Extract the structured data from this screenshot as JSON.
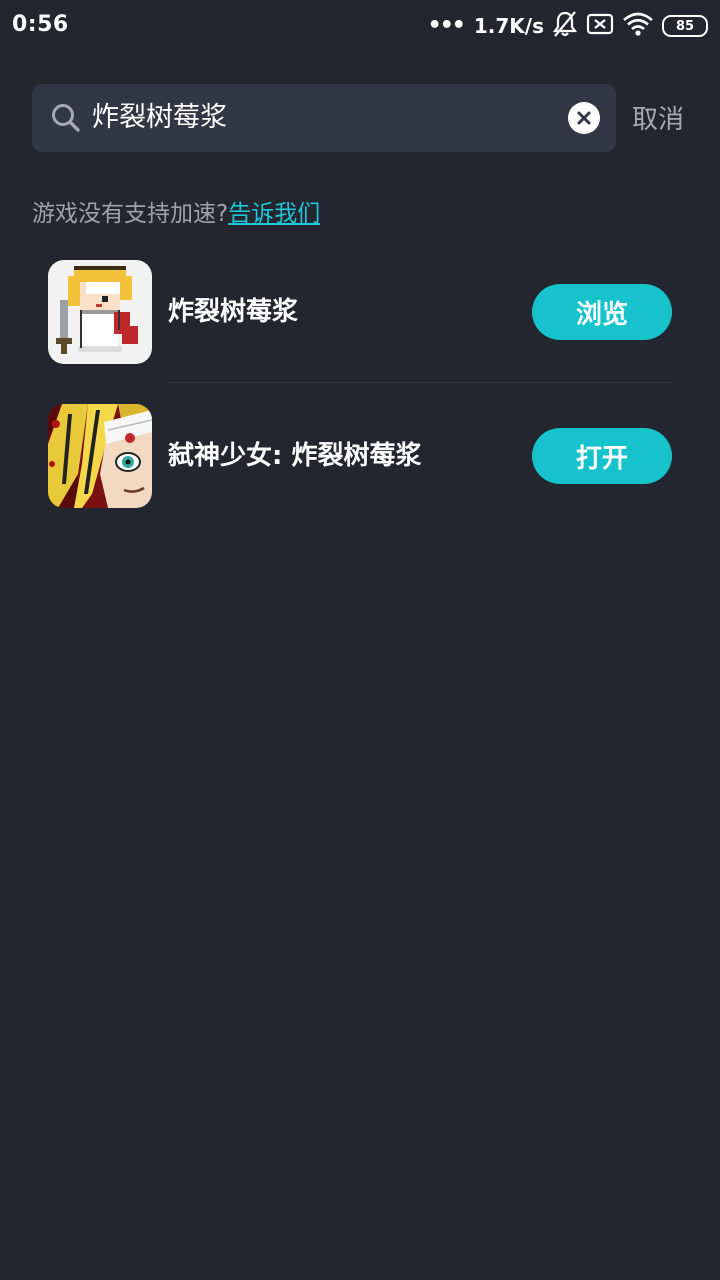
{
  "status_bar": {
    "time": "0:56",
    "dots": "•••",
    "network_speed": "1.7K/s",
    "battery": "85"
  },
  "search": {
    "query": "炸裂树莓浆",
    "cancel_label": "取消"
  },
  "notice": {
    "text": "游戏没有支持加速?",
    "link_text": "告诉我们"
  },
  "results": [
    {
      "name": "炸裂树莓浆",
      "action": "浏览",
      "icon": "pixel-knight-game-icon"
    },
    {
      "name": "弑神少女: 炸裂树莓浆",
      "action": "打开",
      "icon": "anime-girl-game-icon"
    }
  ],
  "colors": {
    "background": "#23252f",
    "search_box": "#333745",
    "accent": "#16c3cd",
    "link": "#1ec6d8"
  }
}
